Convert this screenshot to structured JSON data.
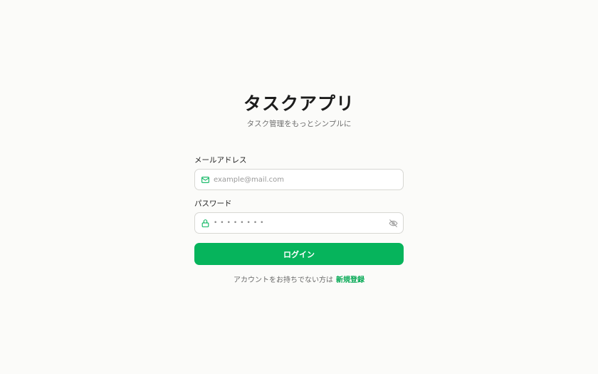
{
  "app": {
    "title": "タスクアプリ",
    "subtitle": "タスク管理をもっとシンプルに"
  },
  "form": {
    "email_label": "メールアドレス",
    "email_placeholder": "example@mail.com",
    "email_value": "",
    "email_icon": "mail-icon",
    "password_label": "パスワード",
    "password_value": "••••••••",
    "password_icon": "lock-icon",
    "password_toggle_icon": "eye-off-icon",
    "login_button": "ログイン"
  },
  "footer": {
    "text": "アカウントをお持ちでない方は",
    "signup_link": "新規登録"
  },
  "colors": {
    "accent": "#06b45c",
    "background": "#fbfbf9"
  }
}
